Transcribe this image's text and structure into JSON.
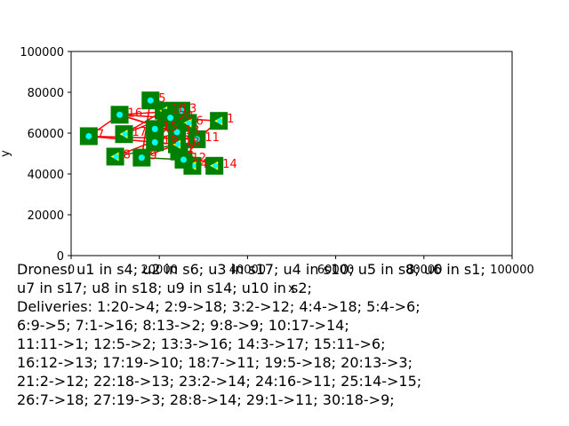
{
  "chart_data": {
    "type": "scatter",
    "xlabel": "x",
    "ylabel": "y",
    "xlim": [
      0,
      100000
    ],
    "ylim": [
      0,
      100000
    ],
    "x_ticks": [
      0,
      20000,
      40000,
      60000,
      80000,
      100000
    ],
    "y_ticks": [
      0,
      20000,
      40000,
      60000,
      80000,
      100000
    ],
    "grid": false,
    "colors": {
      "node_fill": "#008000",
      "node_marker": "#00ffff",
      "node_label": "#ff0000",
      "edge_red": "#ff0000",
      "edge_green": "#1a6b00",
      "drone_marker": "#ffff00"
    },
    "nodes": [
      {
        "label": "1",
        "x": 33500,
        "y": 66000
      },
      {
        "label": "2",
        "x": 24500,
        "y": 51000
      },
      {
        "label": "3",
        "x": 25000,
        "y": 71000
      },
      {
        "label": "4",
        "x": 27500,
        "y": 44000
      },
      {
        "label": "5",
        "x": 18000,
        "y": 76000
      },
      {
        "label": "6",
        "x": 26500,
        "y": 65000
      },
      {
        "label": "7",
        "x": 4000,
        "y": 58500
      },
      {
        "label": "8",
        "x": 10000,
        "y": 48500
      },
      {
        "label": "9",
        "x": 16000,
        "y": 48000
      },
      {
        "label": "10",
        "x": 21000,
        "y": 71000
      },
      {
        "label": "11",
        "x": 28500,
        "y": 57000
      },
      {
        "label": "12",
        "x": 25500,
        "y": 47000
      },
      {
        "label": "13",
        "x": 24000,
        "y": 60500
      },
      {
        "label": "14",
        "x": 32500,
        "y": 44000
      },
      {
        "label": "15",
        "x": 19000,
        "y": 62000
      },
      {
        "label": "16",
        "x": 11000,
        "y": 69000
      },
      {
        "label": "17",
        "x": 12000,
        "y": 59500
      },
      {
        "label": "18",
        "x": 24000,
        "y": 54500
      },
      {
        "label": "19",
        "x": 19000,
        "y": 55500
      },
      {
        "label": "20",
        "x": 22500,
        "y": 67500
      }
    ],
    "edges_red": [
      [
        2,
        4
      ],
      [
        2,
        12
      ],
      [
        2,
        6
      ],
      [
        2,
        14
      ],
      [
        2,
        18
      ],
      [
        3,
        12
      ],
      [
        3,
        16
      ],
      [
        3,
        17
      ],
      [
        4,
        18
      ],
      [
        4,
        6
      ],
      [
        4,
        2
      ],
      [
        5,
        6
      ],
      [
        5,
        2
      ],
      [
        5,
        18
      ],
      [
        7,
        11
      ],
      [
        7,
        18
      ],
      [
        7,
        16
      ],
      [
        8,
        13
      ],
      [
        9,
        5
      ],
      [
        9,
        18
      ],
      [
        10,
        17
      ],
      [
        11,
        1
      ],
      [
        11,
        6
      ],
      [
        12,
        13
      ],
      [
        13,
        3
      ],
      [
        13,
        16
      ],
      [
        16,
        11
      ],
      [
        18,
        13
      ],
      [
        18,
        9
      ],
      [
        20,
        4
      ],
      [
        1,
        16
      ],
      [
        1,
        11
      ]
    ],
    "edges_green": [
      [
        9,
        12
      ],
      [
        8,
        18
      ],
      [
        19,
        10
      ],
      [
        19,
        3
      ]
    ],
    "drones": [
      {
        "name": "u1",
        "at": 4
      },
      {
        "name": "u2",
        "at": 6
      },
      {
        "name": "u3",
        "at": 17
      },
      {
        "name": "u4",
        "at": 10
      },
      {
        "name": "u5",
        "at": 8
      },
      {
        "name": "u6",
        "at": 1
      },
      {
        "name": "u7",
        "at": 17
      },
      {
        "name": "u8",
        "at": 18
      },
      {
        "name": "u9",
        "at": 14
      },
      {
        "name": "u10",
        "at": 2
      }
    ]
  },
  "caption": {
    "lines": [
      "Drones: u1 in s4; u2 in s6; u3 in s17; u4 in s10; u5 in s8; u6 in s1;",
      "u7 in s17; u8 in s18; u9 in s14; u10 in s2;",
      "Deliveries: 1:20->4; 2:9->18; 3:2->12; 4:4->18; 5:4->6;",
      "6:9->5; 7:1->16; 8:13->2; 9:8->9; 10:17->14;",
      "11:11->1; 12:5->2; 13:3->16; 14:3->17; 15:11->6;",
      "16:12->13; 17:19->10; 18:7->11; 19:5->18; 20:13->3;",
      "21:2->12; 22:18->13; 23:2->14; 24:16->11; 25:14->15;",
      "26:7->18; 27:19->3; 28:8->14; 29:1->11; 30:18->9;"
    ]
  }
}
